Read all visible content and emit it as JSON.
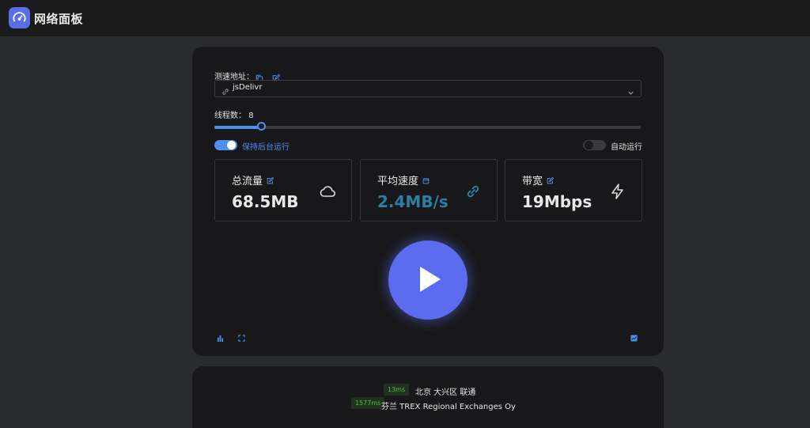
{
  "header": {
    "title": "网络面板",
    "logo_icon": "speedometer-icon"
  },
  "speed_test": {
    "url_label": "测速地址：",
    "url_select_value": "jsDelivr",
    "threads_label": "线程数：",
    "threads_value": "8",
    "threads_fraction": 0.11,
    "keep_background_label": "保持后台运行",
    "keep_background_on": true,
    "auto_run_label": "自动运行",
    "auto_run_on": false
  },
  "stats": [
    {
      "title": "总流量",
      "value": "68.5MB",
      "icon": "cloud-icon",
      "title_icon": "edit-icon"
    },
    {
      "title": "平均速度",
      "value": "2.4MB/s",
      "icon": "link-icon",
      "title_icon": "calendar-icon"
    },
    {
      "title": "带宽",
      "value": "19Mbps",
      "icon": "lightning-icon",
      "title_icon": "edit-icon"
    }
  ],
  "colors": {
    "accent": "#4e8ff0",
    "play": "#5b6cf0",
    "speed": "#2b7fa3",
    "ping_green": "#4fbf3a"
  },
  "pings": [
    {
      "ms": "13ms",
      "location": "北京 大兴区 联通"
    },
    {
      "ms": "1577ms",
      "location": "芬兰 TREX Regional Exchanges Oy"
    }
  ]
}
